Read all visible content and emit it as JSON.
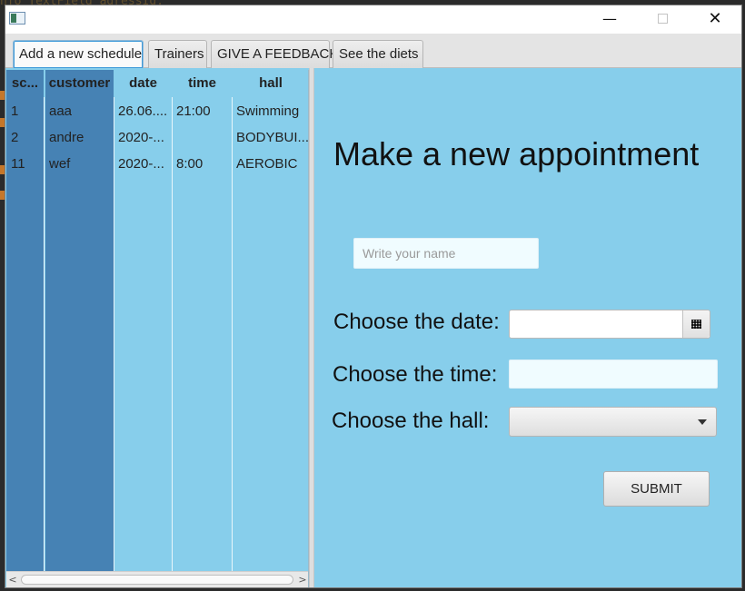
{
  "background_code": "nfo TextField adressId;",
  "window": {
    "minimize_glyph": "—",
    "close_glyph": "✕"
  },
  "tabs": [
    {
      "label": "Add a new schedule",
      "active": true
    },
    {
      "label": "Trainers",
      "active": false
    },
    {
      "label": "GIVE A FEEDBACK",
      "active": false
    },
    {
      "label": "See the diets",
      "active": false
    }
  ],
  "table": {
    "columns": [
      "sc...",
      "customer",
      "date",
      "time",
      "hall"
    ],
    "rows": [
      [
        "1",
        "aaa",
        "26.06....",
        "21:00",
        "Swimming"
      ],
      [
        "2",
        "andre",
        "2020-...",
        "",
        "BODYBUI..."
      ],
      [
        "11",
        "wef",
        "2020-...",
        "8:00",
        "AEROBIC"
      ]
    ],
    "scroll_left_glyph": "<",
    "scroll_right_glyph": ">"
  },
  "form": {
    "title": "Make a new appointment",
    "name_placeholder": "Write your name",
    "date_label": "Choose the date:",
    "time_label": "Choose the time:",
    "hall_label": "Choose the hall:",
    "submit_label": "SUBMIT"
  },
  "colors": {
    "content_bg": "#87ceeb",
    "selected_column_bg": "#4682b4",
    "tab_focus": "#3e9ad9"
  },
  "icons": [
    "app-icon",
    "minimize-icon",
    "maximize-icon",
    "close-icon",
    "calendar-icon",
    "chevron-down-icon"
  ]
}
